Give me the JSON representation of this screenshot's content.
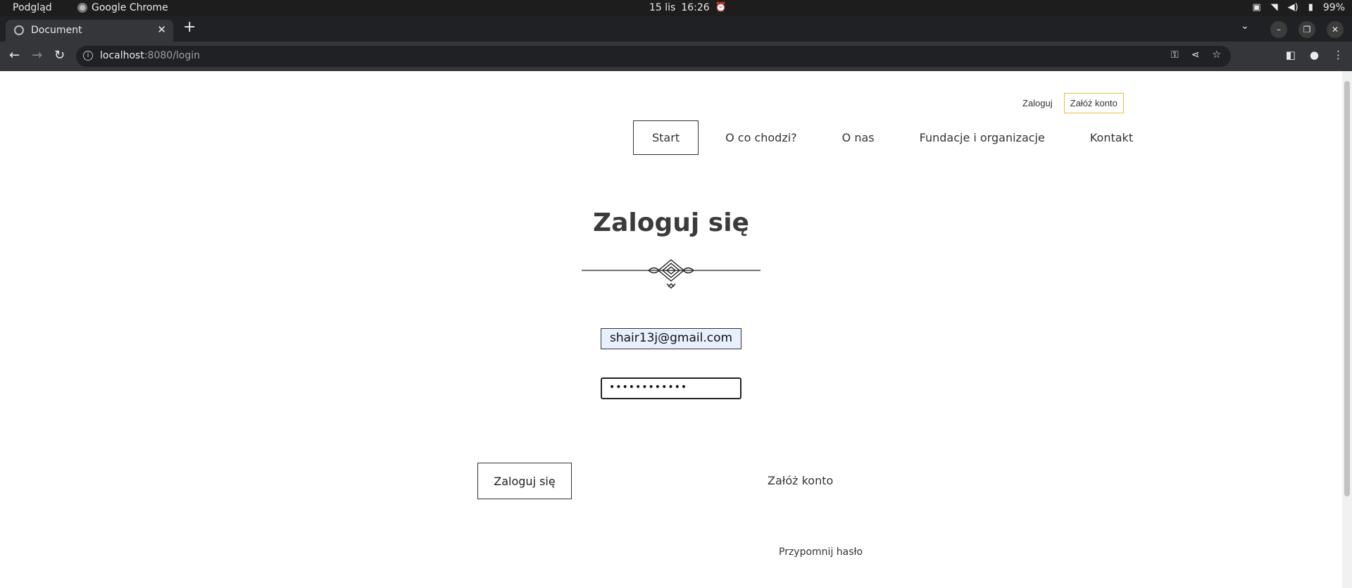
{
  "os_bar": {
    "app_menu": "Podgląd",
    "chrome_menu": "Google Chrome",
    "date": "15 lis",
    "time": "16:26",
    "battery": "99%"
  },
  "browser": {
    "tab_title": "Document",
    "url_host": "localhost",
    "url_path": ":8080/login"
  },
  "header": {
    "login_link": "Zaloguj",
    "register_link": "Załóż konto"
  },
  "nav": {
    "items": [
      {
        "label": "Start",
        "active": true
      },
      {
        "label": "O co chodzi?"
      },
      {
        "label": "O nas"
      },
      {
        "label": "Fundacje i organizacje"
      },
      {
        "label": "Kontakt"
      }
    ]
  },
  "login": {
    "title": "Zaloguj się",
    "email_value": "shair13j@gmail.com",
    "password_value": "••••••••••••",
    "submit_label": "Zaloguj się",
    "register_label": "Załóż konto",
    "remind_label": "Przypomnij hasło"
  }
}
